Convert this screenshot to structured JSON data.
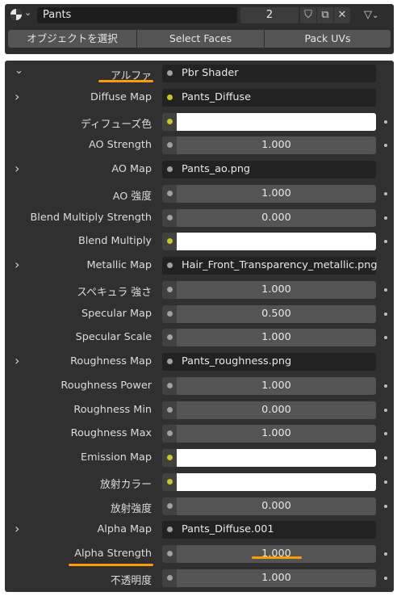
{
  "header": {
    "material_name": "Pants",
    "users_count": "2",
    "shield_glyph": "⛉",
    "copy_glyph": "⧉",
    "close_glyph": "✕",
    "node_glyph": "▽"
  },
  "actions": {
    "select_object": "オブジェクトを選択",
    "select_faces": "Select Faces",
    "pack_uvs": "Pack UVs"
  },
  "properties": [
    {
      "label": "アルファ",
      "type": "link",
      "value": "Pbr Shader",
      "expand": true,
      "expanded": true,
      "sock": "gray"
    },
    {
      "label": "Diffuse Map",
      "type": "link",
      "value": "Pants_Diffuse",
      "expand": true,
      "sock": "yellow"
    },
    {
      "label": "ディフューズ色",
      "type": "color",
      "value": "",
      "sock": "yellow"
    },
    {
      "label": "AO Strength",
      "type": "number",
      "value": "1.000",
      "sock": "gray"
    },
    {
      "label": "AO Map",
      "type": "link",
      "value": "Pants_ao.png",
      "expand": true,
      "sock": "gray"
    },
    {
      "label": "AO 強度",
      "type": "number",
      "value": "1.000",
      "sock": "gray"
    },
    {
      "label": "Blend Multiply Strength",
      "type": "number",
      "value": "0.000",
      "sock": "gray"
    },
    {
      "label": "Blend Multiply",
      "type": "color",
      "value": "",
      "sock": "yellow"
    },
    {
      "label": "Metallic Map",
      "type": "link",
      "value": "Hair_Front_Transparency_metallic.png",
      "expand": true,
      "sock": "gray"
    },
    {
      "label": "スペキュラ 強さ",
      "type": "number",
      "value": "1.000",
      "sock": "gray"
    },
    {
      "label": "Specular Map",
      "type": "number",
      "value": "0.500",
      "sock": "gray"
    },
    {
      "label": "Specular Scale",
      "type": "number",
      "value": "1.000",
      "sock": "gray"
    },
    {
      "label": "Roughness Map",
      "type": "link",
      "value": "Pants_roughness.png",
      "expand": true,
      "sock": "gray"
    },
    {
      "label": "Roughness Power",
      "type": "number",
      "value": "1.000",
      "sock": "gray"
    },
    {
      "label": "Roughness Min",
      "type": "number",
      "value": "0.000",
      "sock": "gray"
    },
    {
      "label": "Roughness Max",
      "type": "number",
      "value": "1.000",
      "sock": "gray"
    },
    {
      "label": "Emission Map",
      "type": "color",
      "value": "",
      "sock": "yellow"
    },
    {
      "label": "放射カラー",
      "type": "color",
      "value": "",
      "sock": "yellow"
    },
    {
      "label": "放射強度",
      "type": "number",
      "value": "0.000",
      "sock": "gray"
    },
    {
      "label": "Alpha Map",
      "type": "link",
      "value": "Pants_Diffuse.001",
      "expand": true,
      "sock": "gray"
    },
    {
      "label": "Alpha Strength",
      "type": "number",
      "value": "1.000",
      "sock": "gray"
    },
    {
      "label": "不透明度",
      "type": "number",
      "value": "1.000",
      "sock": "gray"
    }
  ],
  "colors": {
    "highlight": "#ff9a00",
    "socket_yellow": "#c7c729",
    "socket_gray": "#a1a1a1"
  }
}
